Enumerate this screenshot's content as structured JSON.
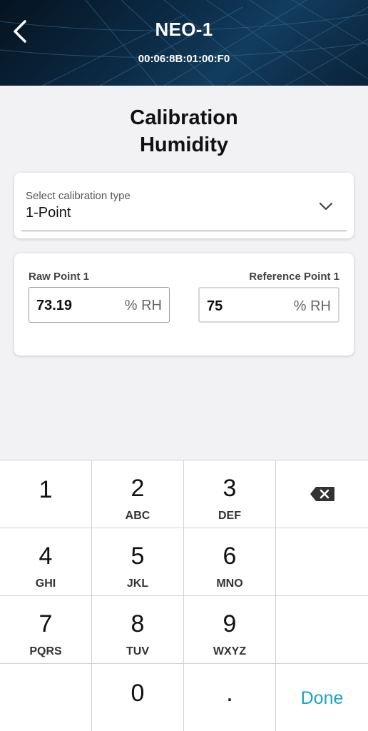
{
  "header": {
    "title": "NEO-1",
    "subtitle": "00:06:8B:01:00:F0",
    "back_icon": "chevron-left-icon"
  },
  "page": {
    "title_line1": "Calibration",
    "title_line2": "Humidity"
  },
  "calibration_select": {
    "label": "Select calibration type",
    "value": "1-Point",
    "icon": "chevron-down-icon"
  },
  "points": {
    "raw": {
      "label": "Raw Point 1",
      "value": "73.19",
      "unit": "% RH"
    },
    "reference": {
      "label": "Reference Point 1",
      "value": "75",
      "unit": "% RH"
    }
  },
  "keypad": {
    "keys": [
      {
        "num": "1",
        "letters": ""
      },
      {
        "num": "2",
        "letters": "ABC"
      },
      {
        "num": "3",
        "letters": "DEF"
      },
      {
        "num": "4",
        "letters": "GHI"
      },
      {
        "num": "5",
        "letters": "JKL"
      },
      {
        "num": "6",
        "letters": "MNO"
      },
      {
        "num": "7",
        "letters": "PQRS"
      },
      {
        "num": "8",
        "letters": "TUV"
      },
      {
        "num": "9",
        "letters": "WXYZ"
      },
      {
        "num": "0",
        "letters": ""
      },
      {
        "num": ".",
        "letters": ""
      }
    ],
    "done_label": "Done",
    "backspace_icon": "backspace-icon"
  },
  "colors": {
    "accent": "#1ba6c4",
    "header_dark": "#0b2a44",
    "background": "#f2f2f4"
  }
}
